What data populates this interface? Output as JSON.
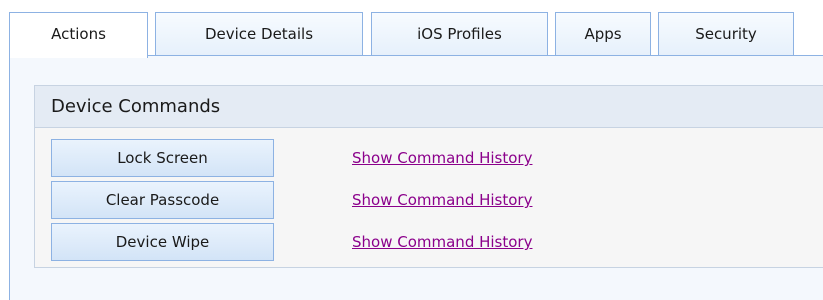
{
  "tabs": [
    {
      "label": "Actions",
      "active": true
    },
    {
      "label": "Device Details",
      "active": false
    },
    {
      "label": "iOS Profiles",
      "active": false
    },
    {
      "label": "Apps",
      "active": false
    },
    {
      "label": "Security",
      "active": false
    }
  ],
  "device_commands": {
    "title": "Device Commands",
    "commands": [
      {
        "button_label": "Lock Screen",
        "link_text": "Show Command History"
      },
      {
        "button_label": "Clear Passcode",
        "link_text": "Show Command History"
      },
      {
        "button_label": "Device Wipe",
        "link_text": "Show Command History"
      }
    ]
  },
  "colors": {
    "tab_border": "#8db2e3",
    "link_visited": "#8b008b",
    "panel_background": "#f4f8fd"
  }
}
